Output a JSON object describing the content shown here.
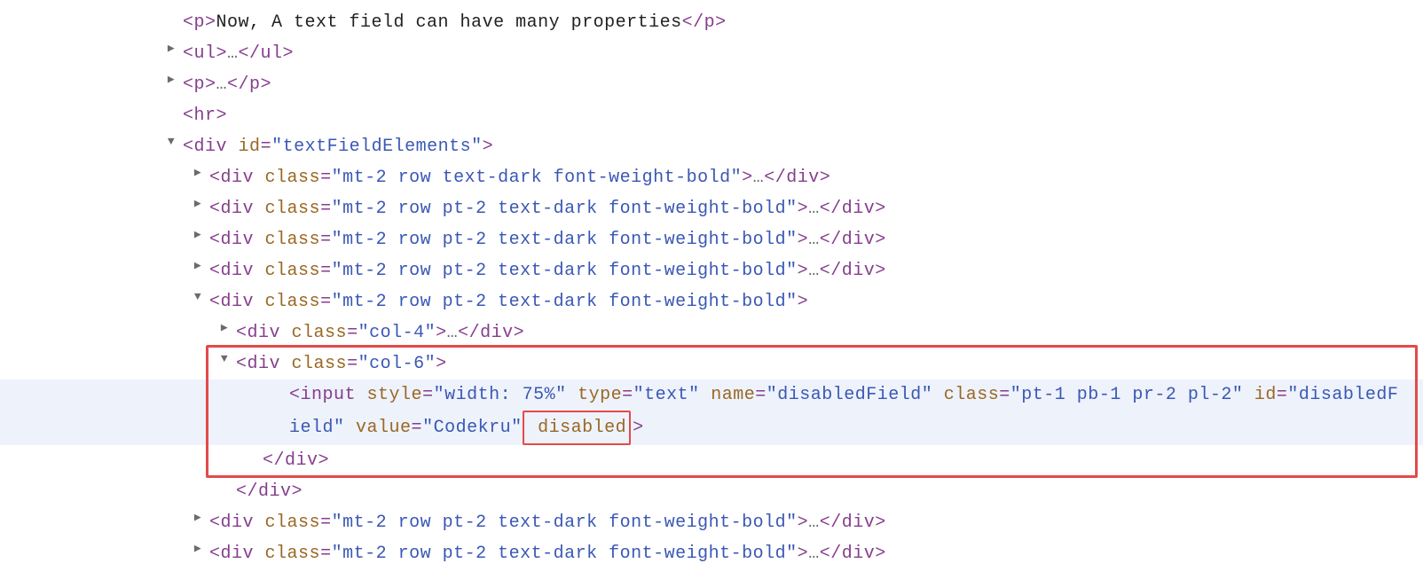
{
  "triangles": {
    "right": "▶",
    "down": "▼"
  },
  "ellipsis": "…",
  "lines": {
    "p_text_open": "<p>",
    "p_text": "Now, A text field can have many properties",
    "p_text_close": "</p>",
    "ul_open": "<ul>",
    "ul_close": "</ul>",
    "p2_open": "<p>",
    "p2_close": "</p>",
    "hr": "<hr>",
    "div_tfe_open_lt": "<",
    "div_tfe_tag": "div",
    "div_tfe_attr_id": "id",
    "div_tfe_attr_id_val": "\"textFieldElements\"",
    "div_tfe_open_gt": ">",
    "row_class_attr": "class",
    "row1_val": "\"mt-2 row text-dark font-weight-bold\"",
    "row_pt2_val": "\"mt-2 row pt-2 text-dark font-weight-bold\"",
    "div_open_lt": "<",
    "div_tag": "div",
    "gt": ">",
    "div_close": "</div>",
    "col4_val": "\"col-4\"",
    "col6_val": "\"col-6\"",
    "input_tag": "input",
    "input_style_attr": "style",
    "input_style_val": "\"width: 75%\"",
    "input_type_attr": "type",
    "input_type_val": "\"text\"",
    "input_name_attr": "name",
    "input_name_val": "\"disabledField\"",
    "input_class_attr": "class",
    "input_class_val": "\"pt-1 pb-1 pr-2 pl-2\"",
    "input_id_attr": "id",
    "input_id_val": "\"disabledField\"",
    "input_value_attr": "value",
    "input_value_val": "\"Codekru\"",
    "input_disabled": "disabled"
  }
}
